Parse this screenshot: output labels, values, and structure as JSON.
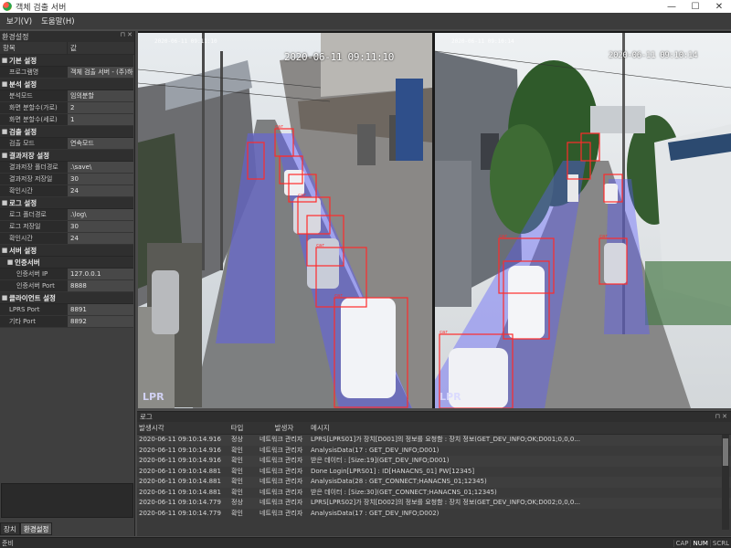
{
  "window": {
    "title": "객체 검출 서버",
    "controls": [
      "—",
      "☐",
      "✕"
    ]
  },
  "menu": [
    "보기(V)",
    "도움말(H)"
  ],
  "settings_panel": {
    "title": "환경설정",
    "header": {
      "name": "항목",
      "value": "값"
    },
    "categories": [
      {
        "label": "기본 설정",
        "rows": [
          {
            "name": "프로그램명",
            "value": "객체 검출 서버 - (주)하..."
          }
        ]
      },
      {
        "label": "분석 설정",
        "rows": [
          {
            "name": "분석모드",
            "value": "임의분할"
          },
          {
            "name": "화면 분할수(가로)",
            "value": "2"
          },
          {
            "name": "화면 분할수(세로)",
            "value": "1"
          }
        ]
      },
      {
        "label": "검출 설정",
        "rows": [
          {
            "name": "검출 모드",
            "value": "연속모드"
          }
        ]
      },
      {
        "label": "결과저장 설정",
        "rows": [
          {
            "name": "결과저장 폴더경로",
            "value": ".\\save\\"
          },
          {
            "name": "결과저장 저장일",
            "value": "30"
          },
          {
            "name": "확인시간",
            "value": "24"
          }
        ]
      },
      {
        "label": "로그 설정",
        "rows": [
          {
            "name": "로그 폴더경로",
            "value": ".\\log\\"
          },
          {
            "name": "로그 저장일",
            "value": "30"
          },
          {
            "name": "확인시간",
            "value": "24"
          }
        ]
      }
    ],
    "server": {
      "label": "서버 설정",
      "subcategory": "인증서버",
      "rows": [
        {
          "name": "인증서버 IP",
          "value": "127.0.0.1"
        },
        {
          "name": "인증서버 Port",
          "value": "8888"
        }
      ]
    },
    "client": {
      "label": "클라이언트 설정",
      "rows": [
        {
          "name": "LPRS Port",
          "value": "8891"
        },
        {
          "name": "기타 Port",
          "value": "8892"
        }
      ]
    },
    "tabs": [
      "장치",
      "환경설정"
    ]
  },
  "cameras": [
    {
      "timestamp": "2020-06-11 09:11:10",
      "small_timestamp": "2020-06-11 09:11:10",
      "badge": "LPR"
    },
    {
      "timestamp": "2020-06-11 09:10:14",
      "small_timestamp": "2020-06-11 09:10:14",
      "badge": "LPR"
    }
  ],
  "log_panel": {
    "title": "로그",
    "columns": [
      "발생시각",
      "타입",
      "발생자",
      "메시지"
    ],
    "rows": [
      {
        "time": "2020-06-11 09:10:14.916",
        "type": "정상",
        "source": "네트워크 관리자",
        "message": "LPRS[LPRS01]가 장치[D001]의 정보를 요청함 : 장치 정보(GET_DEV_INFO;OK;D001;0,0,0..."
      },
      {
        "time": "2020-06-11 09:10:14.916",
        "type": "확인",
        "source": "네트워크 관리자",
        "message": "AnalysisData(17 : GET_DEV_INFO;D001)"
      },
      {
        "time": "2020-06-11 09:10:14.916",
        "type": "확인",
        "source": "네트워크 관리자",
        "message": "받은 데이터 : [Size:19](GET_DEV_INFO;D001)"
      },
      {
        "time": "2020-06-11 09:10:14.881",
        "type": "확인",
        "source": "네트워크 관리자",
        "message": "Done Login[LPRS01] : ID[HANACNS_01] PW[12345]"
      },
      {
        "time": "2020-06-11 09:10:14.881",
        "type": "확인",
        "source": "네트워크 관리자",
        "message": "AnalysisData(28 : GET_CONNECT;HANACNS_01;12345)"
      },
      {
        "time": "2020-06-11 09:10:14.881",
        "type": "확인",
        "source": "네트워크 관리자",
        "message": "받은 데이터 : [Size:30](GET_CONNECT;HANACNS_01;12345)"
      },
      {
        "time": "2020-06-11 09:10:14.779",
        "type": "정상",
        "source": "네트워크 관리자",
        "message": "LPRS[LPRS02]가 장치[D002]의 정보를 요청함 : 장치 정보(GET_DEV_INFO;OK;D002;0,0,0..."
      },
      {
        "time": "2020-06-11 09:10:14.779",
        "type": "확인",
        "source": "네트워크 관리자",
        "message": "AnalysisData(17 : GET_DEV_INFO;D002)"
      }
    ]
  },
  "statusbar": {
    "text": "준비",
    "indicators": [
      "CAP",
      "NUM",
      "SCRL"
    ]
  },
  "colors": {
    "detection_box": "#ff2b2b",
    "road_overlay": "#5a5aff",
    "window_bg": "#4a4a4a"
  }
}
